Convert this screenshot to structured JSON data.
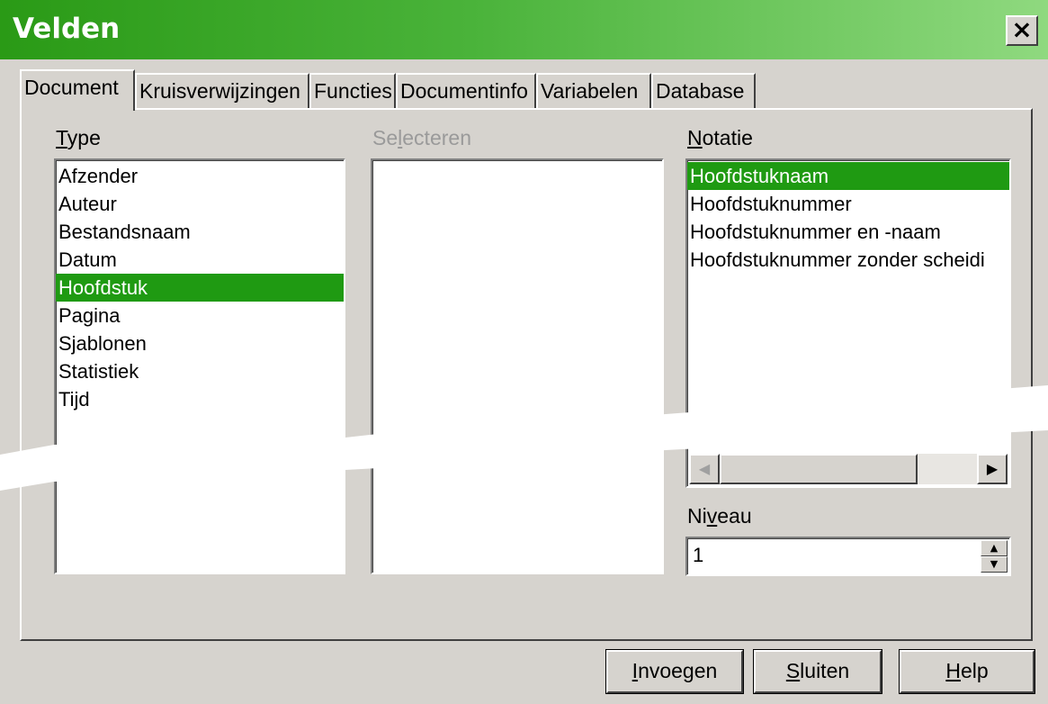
{
  "window": {
    "title": "Velden",
    "close_label": "×"
  },
  "tabs": [
    {
      "label": "Document",
      "active": true
    },
    {
      "label": "Kruisverwijzingen",
      "active": false
    },
    {
      "label": "Functies",
      "active": false
    },
    {
      "label": "Documentinfo",
      "active": false
    },
    {
      "label": "Variabelen",
      "active": false
    },
    {
      "label": "Database",
      "active": false
    }
  ],
  "type": {
    "label_first": "T",
    "label_rest": "ype",
    "items": [
      "Afzender",
      "Auteur",
      "Bestandsnaam",
      "Datum",
      "Hoofdstuk",
      "Pagina",
      "Sjablonen",
      "Statistiek",
      "Tijd"
    ],
    "selected": "Hoofdstuk"
  },
  "select": {
    "label_pre": "Se",
    "label_u": "l",
    "label_post": "ecteren",
    "items": []
  },
  "notatie": {
    "label_first": "N",
    "label_rest": "otatie",
    "items": [
      "Hoofdstuknaam",
      "Hoofdstuknummer",
      "Hoofdstuknummer en -naam",
      "Hoofdstuknummer zonder scheidi"
    ],
    "selected": "Hoofdstuknaam",
    "scroll_left": "◀",
    "scroll_right": "▶"
  },
  "niveau": {
    "label_pre": "Ni",
    "label_u": "v",
    "label_post": "eau",
    "value": "1",
    "up": "▲",
    "down": "▼"
  },
  "buttons": {
    "insert_u": "I",
    "insert_rest": "nvoegen",
    "close_u": "S",
    "close_rest": "luiten",
    "help_u": "H",
    "help_rest": "elp"
  },
  "colors": {
    "title_gradient_start": "#2a9a16",
    "title_gradient_end": "#8fd97f",
    "selection": "#1f9a12",
    "dialog_bg": "#d6d3ce"
  }
}
